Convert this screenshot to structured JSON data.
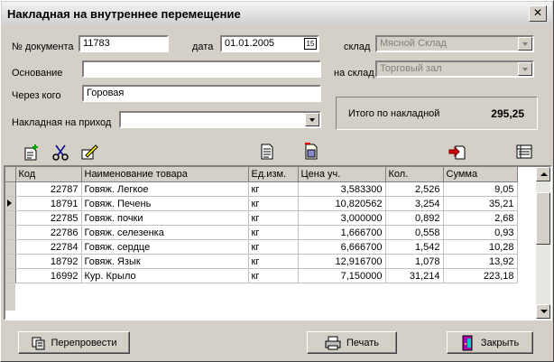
{
  "window": {
    "title": "Накладная на внутреннее перемещение",
    "close_glyph": "✕"
  },
  "form": {
    "doc_number_label": "№ документа",
    "doc_number_value": "11783",
    "date_label": "дата",
    "date_value": "01.01.2005",
    "calendar_glyph": "15",
    "basis_label": "Основание",
    "basis_value": "",
    "via_label": "Через кого",
    "via_value": "Горовая",
    "incoming_label": "Накладная  на приход",
    "incoming_value": "",
    "warehouse_label": "склад",
    "warehouse_value": "Мясной Склад",
    "to_warehouse_label": "на склад",
    "to_warehouse_value": "Торговый зал",
    "total_label": "Итого по накладной",
    "total_value": "295,25"
  },
  "toolbar": {
    "icons": [
      "add-document-icon",
      "scissors-icon",
      "edit-icon",
      "document-icon",
      "calculator-document-icon",
      "import-icon",
      "register-icon"
    ]
  },
  "table": {
    "columns": [
      "Код",
      "Наименование товара",
      "Ед.изм.",
      "Цена уч.",
      "Кол.",
      "Сумма"
    ],
    "rows": [
      [
        "22787",
        "Говяж. Легкое",
        "кг",
        "3,583300",
        "2,526",
        "9,05"
      ],
      [
        "18791",
        "Говяж. Печень",
        "кг",
        "10,820562",
        "3,254",
        "35,21"
      ],
      [
        "22785",
        "Говяж. почки",
        "кг",
        "3,000000",
        "0,892",
        "2,68"
      ],
      [
        "22786",
        "Говяж. селезенка",
        "кг",
        "1,666700",
        "0,558",
        "0,93"
      ],
      [
        "22784",
        "Говяж. сердце",
        "кг",
        "6,666700",
        "1,542",
        "10,28"
      ],
      [
        "18792",
        "Говяж. Язык",
        "кг",
        "12,916700",
        "1,078",
        "13,92"
      ],
      [
        "16992",
        "Кур. Крыло",
        "кг",
        "7,150000",
        "31,214",
        "223,18"
      ]
    ],
    "current_row": 1
  },
  "buttons": {
    "repost_label": "Перепровести",
    "print_label": "Печать",
    "close_label": "Закрыть"
  }
}
